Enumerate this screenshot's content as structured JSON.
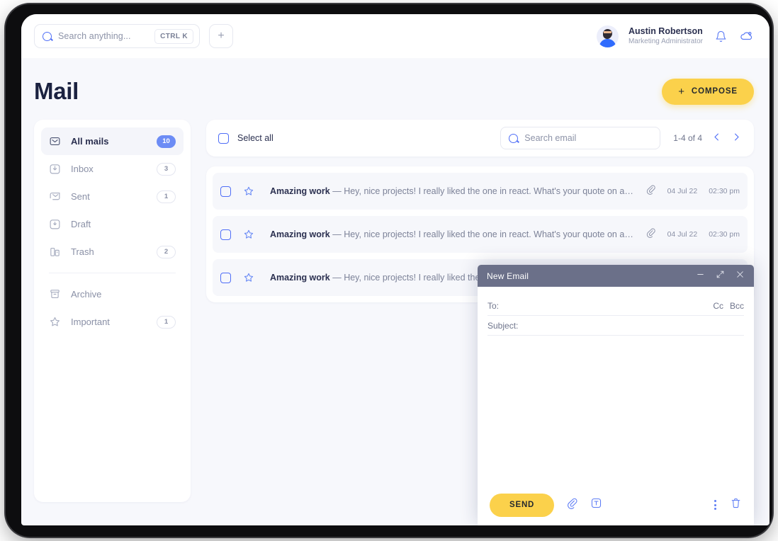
{
  "topbar": {
    "search_placeholder": "Search anything...",
    "search_shortcut": "CTRL K",
    "add_label": "+",
    "user_name": "Austin Robertson",
    "user_role": "Marketing Administrator",
    "bell_icon": "bell-icon",
    "support_icon": "chat-cloud-icon"
  },
  "page": {
    "title": "Mail",
    "compose_plus": "+",
    "compose_label": "COMPOSE"
  },
  "sidebar": {
    "items": [
      {
        "label": "All mails",
        "badge": "10",
        "icon": "envelope-icon",
        "active": true
      },
      {
        "label": "Inbox",
        "badge": "3",
        "icon": "inbox-icon",
        "active": false
      },
      {
        "label": "Sent",
        "badge": "1",
        "icon": "sent-icon",
        "active": false
      },
      {
        "label": "Draft",
        "badge": "",
        "icon": "draft-icon",
        "active": false
      },
      {
        "label": "Trash",
        "badge": "2",
        "icon": "trash-icon",
        "active": false
      }
    ],
    "items2": [
      {
        "label": "Archive",
        "badge": "",
        "icon": "archive-icon",
        "active": false
      },
      {
        "label": "Important",
        "badge": "1",
        "icon": "star-icon",
        "active": false
      }
    ]
  },
  "list_header": {
    "select_all_label": "Select all",
    "search_placeholder": "Search email",
    "pagination": "1-4 of 4",
    "prev_icon": "chevron-left-icon",
    "next_icon": "chevron-right-icon"
  },
  "emails": [
    {
      "subject": "Amazing work",
      "separator": " — ",
      "preview": "Hey, nice projects! I really liked the one in react. What's your quote on a simil...",
      "date": "04 Jul 22",
      "time": "02:30 pm",
      "has_attachment": true
    },
    {
      "subject": "Amazing work",
      "separator": " — ",
      "preview": "Hey, nice projects! I really liked the one in react. What's your quote on a simil...",
      "date": "04 Jul 22",
      "time": "02:30 pm",
      "has_attachment": true
    },
    {
      "subject": "Amazing work",
      "separator": " — ",
      "preview": "Hey, nice projects! I really liked the one in rea",
      "date": "",
      "time": "",
      "has_attachment": false
    }
  ],
  "compose_dialog": {
    "title": "New Email",
    "minimize_icon": "minimize-icon",
    "expand_icon": "expand-icon",
    "close_icon": "close-icon",
    "to_label": "To:",
    "cc_label": "Cc",
    "bcc_label": "Bcc",
    "subject_label": "Subject:",
    "send_label": "SEND",
    "attach_icon": "paperclip-icon",
    "text_icon": "text-format-icon",
    "more_icon": "more-vertical-icon",
    "delete_icon": "trash-icon"
  },
  "colors": {
    "accent_yellow": "#FBD14B",
    "accent_blue": "#6C8CF5",
    "icon_blue": "#5D7CF5",
    "dialog_header": "#6B7089",
    "background": "#F7F8FC",
    "text_dark": "#2B3050"
  }
}
